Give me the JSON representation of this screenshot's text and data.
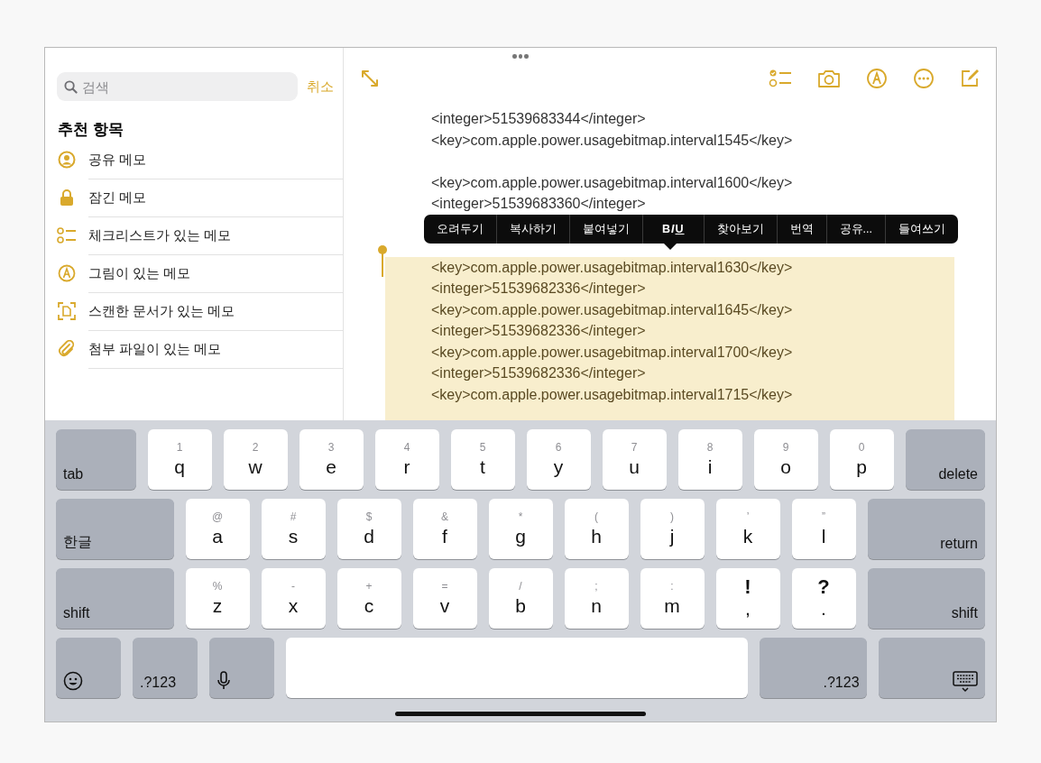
{
  "sidebar": {
    "search": {
      "placeholder": "검색"
    },
    "cancel": "취소",
    "heading": "추천 항목",
    "items": [
      {
        "label": "공유 메모",
        "kind": "shared"
      },
      {
        "label": "잠긴 메모",
        "kind": "locked"
      },
      {
        "label": "체크리스트가 있는 메모",
        "kind": "checklist"
      },
      {
        "label": "그림이 있는 메모",
        "kind": "drawing"
      },
      {
        "label": "스캔한 문서가 있는 메모",
        "kind": "scan"
      },
      {
        "label": "첨부 파일이 있는 메모",
        "kind": "attachment"
      }
    ]
  },
  "note": {
    "lines": [
      {
        "text": "<integer>51539683344</integer>",
        "selected": false,
        "gap_before": false
      },
      {
        "text": "<key>com.apple.power.usagebitmap.interval1545</key>",
        "selected": false,
        "gap_before": false
      },
      {
        "text": "<key>com.apple.power.usagebitmap.interval1600</key>",
        "selected": false,
        "gap_before": true
      },
      {
        "text": "<integer>51539683360</integer>",
        "selected": false,
        "gap_before": false
      },
      {
        "text": "<key>com.apple.power.usagebitmap.interval1630</key>",
        "selected": true,
        "gap_before": true
      },
      {
        "text": "<integer>51539682336</integer>",
        "selected": true,
        "gap_before": false
      },
      {
        "text": "<key>com.apple.power.usagebitmap.interval1645</key>",
        "selected": true,
        "gap_before": false
      },
      {
        "text": "<integer>51539682336</integer>",
        "selected": true,
        "gap_before": false
      },
      {
        "text": "<key>com.apple.power.usagebitmap.interval1700</key>",
        "selected": true,
        "gap_before": false
      },
      {
        "text": "<integer>51539682336</integer>",
        "selected": true,
        "gap_before": false
      },
      {
        "text": "<key>com.apple.power.usagebitmap.interval1715</key>",
        "selected": true,
        "gap_before": false
      }
    ]
  },
  "context_menu": [
    {
      "kind": "text",
      "label": "오려두기"
    },
    {
      "kind": "text",
      "label": "복사하기"
    },
    {
      "kind": "text",
      "label": "붙여넣기"
    },
    {
      "kind": "format",
      "letters": [
        "B",
        "I",
        "U"
      ]
    },
    {
      "kind": "text",
      "label": "찾아보기"
    },
    {
      "kind": "text",
      "label": "번역"
    },
    {
      "kind": "text",
      "label": "공유..."
    },
    {
      "kind": "text",
      "label": "들여쓰기"
    }
  ],
  "keyboard": {
    "rows": [
      [
        {
          "kind": "function",
          "label": "tab"
        },
        {
          "kind": "letter",
          "label": "q",
          "hint": "1"
        },
        {
          "kind": "letter",
          "label": "w",
          "hint": "2"
        },
        {
          "kind": "letter",
          "label": "e",
          "hint": "3"
        },
        {
          "kind": "letter",
          "label": "r",
          "hint": "4"
        },
        {
          "kind": "letter",
          "label": "t",
          "hint": "5"
        },
        {
          "kind": "letter",
          "label": "y",
          "hint": "6"
        },
        {
          "kind": "letter",
          "label": "u",
          "hint": "7"
        },
        {
          "kind": "letter",
          "label": "i",
          "hint": "8"
        },
        {
          "kind": "letter",
          "label": "o",
          "hint": "9"
        },
        {
          "kind": "letter",
          "label": "p",
          "hint": "0"
        },
        {
          "kind": "function",
          "label": "delete"
        }
      ],
      [
        {
          "kind": "function",
          "label": "한글"
        },
        {
          "kind": "letter",
          "label": "a",
          "hint": "@"
        },
        {
          "kind": "letter",
          "label": "s",
          "hint": "#"
        },
        {
          "kind": "letter",
          "label": "d",
          "hint": "$"
        },
        {
          "kind": "letter",
          "label": "f",
          "hint": "&"
        },
        {
          "kind": "letter",
          "label": "g",
          "hint": "*"
        },
        {
          "kind": "letter",
          "label": "h",
          "hint": "("
        },
        {
          "kind": "letter",
          "label": "j",
          "hint": ")"
        },
        {
          "kind": "letter",
          "label": "k",
          "hint": "’"
        },
        {
          "kind": "letter",
          "label": "l",
          "hint": "”"
        },
        {
          "kind": "function",
          "label": "return"
        }
      ],
      [
        {
          "kind": "function",
          "label": "shift"
        },
        {
          "kind": "letter",
          "label": "z",
          "hint": "%"
        },
        {
          "kind": "letter",
          "label": "x",
          "hint": "-"
        },
        {
          "kind": "letter",
          "label": "c",
          "hint": "+"
        },
        {
          "kind": "letter",
          "label": "v",
          "hint": "="
        },
        {
          "kind": "letter",
          "label": "b",
          "hint": "/"
        },
        {
          "kind": "letter",
          "label": "n",
          "hint": ";"
        },
        {
          "kind": "letter",
          "label": "m",
          "hint": ":"
        },
        {
          "kind": "symbol",
          "label": ",",
          "hint": "!"
        },
        {
          "kind": "symbol",
          "label": ".",
          "hint": "?"
        },
        {
          "kind": "function",
          "label": "shift"
        }
      ],
      [
        {
          "kind": "emoji"
        },
        {
          "kind": "mode",
          "label": ".?123"
        },
        {
          "kind": "mic"
        },
        {
          "kind": "space"
        },
        {
          "kind": "function",
          "label": ".?123"
        },
        {
          "kind": "hide"
        }
      ]
    ]
  }
}
